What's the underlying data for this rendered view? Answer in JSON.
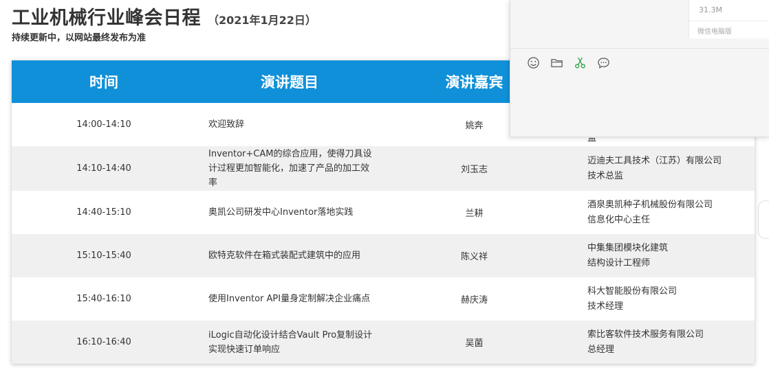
{
  "page": {
    "title": "工业机械行业峰会日程",
    "date": "（2021年1月22日）",
    "subtitle": "持续更新中，以网站最终发布为准"
  },
  "table": {
    "headers": [
      "时间",
      "演讲题目",
      "演讲嘉宾",
      ""
    ],
    "rows": [
      {
        "time": "14:00-14:10",
        "topic": "欢迎致辞",
        "speaker": "姚奔",
        "company": "",
        "role": "监"
      },
      {
        "time": "14:10-14:40",
        "topic": "Inventor+CAM的综合应用，使得刀具设计过程更加智能化，加速了产品的加工效率",
        "speaker": "刘玉志",
        "company": "迈迪夫工具技术（江苏）有限公司",
        "role": "技术总监"
      },
      {
        "time": "14:40-15:10",
        "topic": "奥凯公司研发中心Inventor落地实践",
        "speaker": "兰耕",
        "company": "酒泉奥凯种子机械股份有限公司",
        "role": "信息化中心主任"
      },
      {
        "time": "15:10-15:40",
        "topic": "欧特克软件在箱式装配式建筑中的应用",
        "speaker": "陈义祥",
        "company": "中集集团模块化建筑",
        "role": "结构设计工程师"
      },
      {
        "time": "15:40-16:10",
        "topic": "使用Inventor API量身定制解决企业痛点",
        "speaker": "赫庆涛",
        "company": "科大智能股份有限公司",
        "role": "技术经理"
      },
      {
        "time": "16:10-16:40",
        "topic": "iLogic自动化设计结合Vault Pro复制设计 实现快速订单响应",
        "speaker": "吴菌",
        "company": "索比客软件技术服务有限公司",
        "role": "总经理"
      }
    ]
  },
  "wechat": {
    "file_size": "31.3M",
    "file_source": "微信电脑版",
    "tools": [
      "emoji-icon",
      "folder-icon",
      "scissors-icon",
      "chat-icon"
    ]
  },
  "colors": {
    "header_bg": "#1090d8",
    "alt_row_bg": "#f0f0f0",
    "scissors": "#2ba245"
  }
}
